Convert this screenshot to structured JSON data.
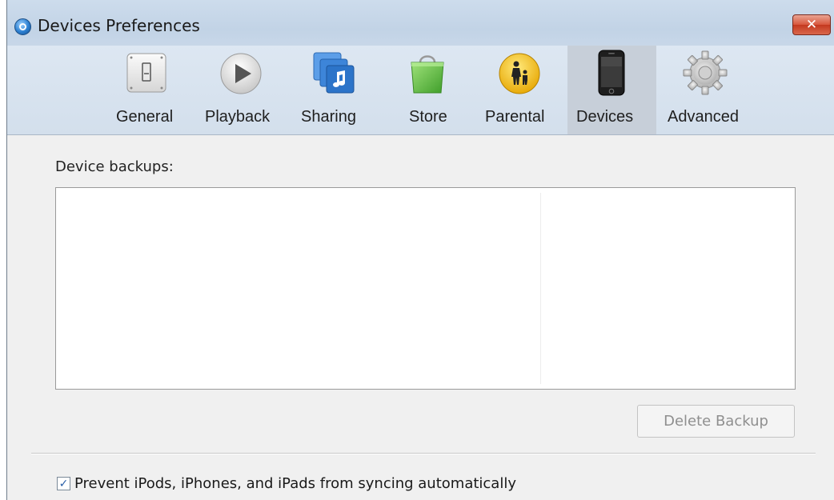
{
  "window": {
    "title": "Devices Preferences",
    "close_glyph": "✕"
  },
  "toolbar": {
    "tabs": [
      {
        "label": "General",
        "icon": "switch-icon",
        "selected": false
      },
      {
        "label": "Playback",
        "icon": "play-icon",
        "selected": false
      },
      {
        "label": "Sharing",
        "icon": "sharing-icon",
        "selected": false
      },
      {
        "label": "Store",
        "icon": "shopping-bag-icon",
        "selected": false
      },
      {
        "label": "Parental",
        "icon": "parental-icon",
        "selected": false
      },
      {
        "label": "Devices",
        "icon": "phone-icon",
        "selected": true
      },
      {
        "label": "Advanced",
        "icon": "gear-icon",
        "selected": false
      }
    ]
  },
  "content": {
    "backups_label": "Device backups:",
    "backups": [],
    "delete_button": "Delete Backup",
    "prevent_sync_checked": true,
    "prevent_sync_label": "Prevent iPods, iPhones, and iPads from syncing automatically"
  },
  "colors": {
    "titlebar": "#c2d3e6",
    "close": "#d8563c",
    "selected_tab": "#c7cfd9"
  }
}
